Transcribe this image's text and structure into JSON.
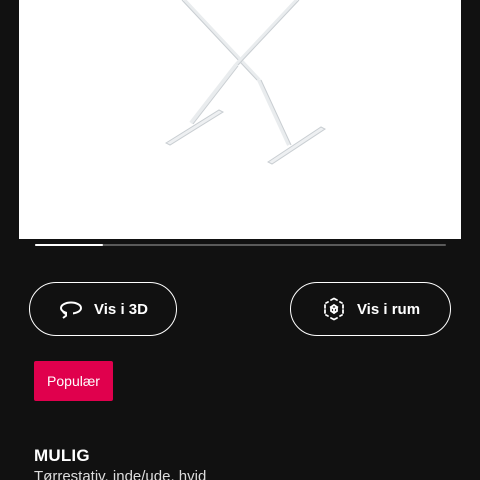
{
  "product": {
    "image_alt": "product-image",
    "name": "MULIG",
    "description": "Tørrestativ, inde/ude, hvid"
  },
  "carousel": {
    "progress": 0.165
  },
  "actions": {
    "view_3d_label": "Vis i 3D",
    "view_in_room_label": "Vis i rum"
  },
  "badge": {
    "label": "Populær"
  },
  "colors": {
    "background": "#111111",
    "badge": "#e0004d",
    "image_background": "#ffffff"
  },
  "icons": {
    "view_3d": "rotate-3d-icon",
    "view_in_room": "ar-room-icon"
  }
}
